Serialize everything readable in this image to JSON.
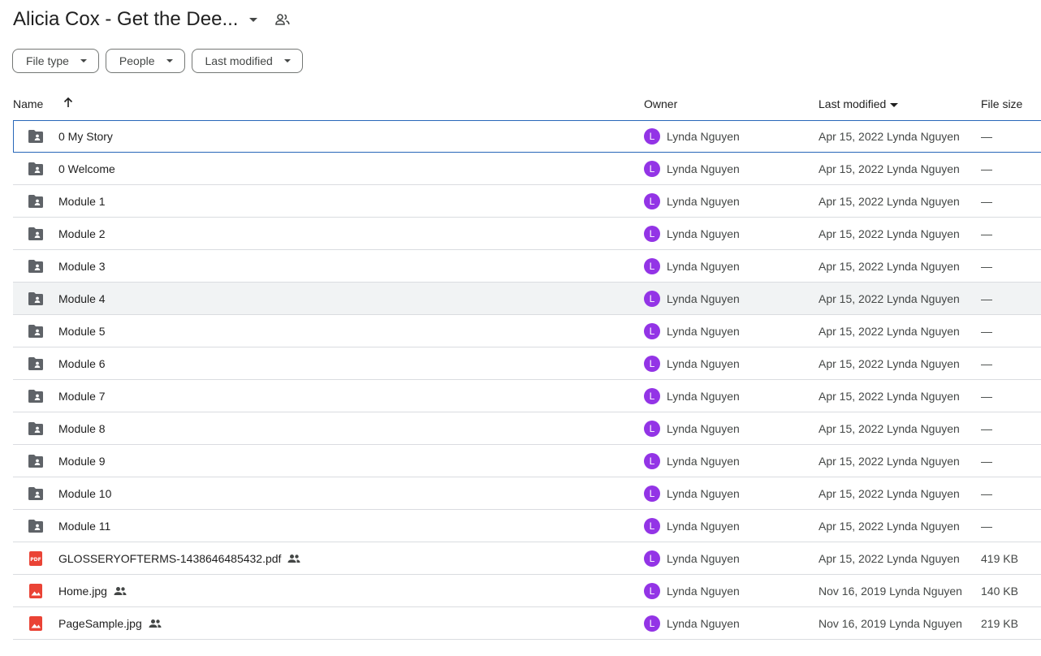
{
  "header": {
    "title": "Alicia Cox - Get the Dee...",
    "icons": [
      "dropdown-caret-icon",
      "shared-people-icon"
    ]
  },
  "filters": [
    {
      "label": "File type"
    },
    {
      "label": "People"
    },
    {
      "label": "Last modified"
    }
  ],
  "columns": {
    "name": "Name",
    "owner": "Owner",
    "last_modified": "Last modified",
    "file_size": "File size"
  },
  "colors": {
    "avatar": "#9334e6",
    "pdf": "#ea4335",
    "image": "#ea4335",
    "folder": "#5f6368",
    "selection_border": "#2867b9",
    "hover_bg": "#f1f3f4"
  },
  "rows": [
    {
      "name": "0 My Story",
      "kind": "folder",
      "shared": false,
      "avatar": "L",
      "owner": "Lynda Nguyen",
      "modified": "Apr 15, 2022 Lynda Nguyen",
      "size": "—"
    },
    {
      "name": "0 Welcome",
      "kind": "folder",
      "shared": false,
      "avatar": "L",
      "owner": "Lynda Nguyen",
      "modified": "Apr 15, 2022 Lynda Nguyen",
      "size": "—"
    },
    {
      "name": "Module 1",
      "kind": "folder",
      "shared": false,
      "avatar": "L",
      "owner": "Lynda Nguyen",
      "modified": "Apr 15, 2022 Lynda Nguyen",
      "size": "—"
    },
    {
      "name": "Module 2",
      "kind": "folder",
      "shared": false,
      "avatar": "L",
      "owner": "Lynda Nguyen",
      "modified": "Apr 15, 2022 Lynda Nguyen",
      "size": "—"
    },
    {
      "name": "Module 3",
      "kind": "folder",
      "shared": false,
      "avatar": "L",
      "owner": "Lynda Nguyen",
      "modified": "Apr 15, 2022 Lynda Nguyen",
      "size": "—"
    },
    {
      "name": "Module 4",
      "kind": "folder",
      "shared": false,
      "avatar": "L",
      "owner": "Lynda Nguyen",
      "modified": "Apr 15, 2022 Lynda Nguyen",
      "size": "—"
    },
    {
      "name": "Module 5",
      "kind": "folder",
      "shared": false,
      "avatar": "L",
      "owner": "Lynda Nguyen",
      "modified": "Apr 15, 2022 Lynda Nguyen",
      "size": "—"
    },
    {
      "name": "Module 6",
      "kind": "folder",
      "shared": false,
      "avatar": "L",
      "owner": "Lynda Nguyen",
      "modified": "Apr 15, 2022 Lynda Nguyen",
      "size": "—"
    },
    {
      "name": "Module 7",
      "kind": "folder",
      "shared": false,
      "avatar": "L",
      "owner": "Lynda Nguyen",
      "modified": "Apr 15, 2022 Lynda Nguyen",
      "size": "—"
    },
    {
      "name": "Module 8",
      "kind": "folder",
      "shared": false,
      "avatar": "L",
      "owner": "Lynda Nguyen",
      "modified": "Apr 15, 2022 Lynda Nguyen",
      "size": "—"
    },
    {
      "name": "Module 9",
      "kind": "folder",
      "shared": false,
      "avatar": "L",
      "owner": "Lynda Nguyen",
      "modified": "Apr 15, 2022 Lynda Nguyen",
      "size": "—"
    },
    {
      "name": "Module 10",
      "kind": "folder",
      "shared": false,
      "avatar": "L",
      "owner": "Lynda Nguyen",
      "modified": "Apr 15, 2022 Lynda Nguyen",
      "size": "—"
    },
    {
      "name": "Module 11",
      "kind": "folder",
      "shared": false,
      "avatar": "L",
      "owner": "Lynda Nguyen",
      "modified": "Apr 15, 2022 Lynda Nguyen",
      "size": "—"
    },
    {
      "name": "GLOSSERYOFTERMS-1438646485432.pdf",
      "kind": "pdf",
      "shared": true,
      "avatar": "L",
      "owner": "Lynda Nguyen",
      "modified": "Apr 15, 2022 Lynda Nguyen",
      "size": "419 KB"
    },
    {
      "name": "Home.jpg",
      "kind": "image",
      "shared": true,
      "avatar": "L",
      "owner": "Lynda Nguyen",
      "modified": "Nov 16, 2019 Lynda Nguyen",
      "size": "140 KB"
    },
    {
      "name": "PageSample.jpg",
      "kind": "image",
      "shared": true,
      "avatar": "L",
      "owner": "Lynda Nguyen",
      "modified": "Nov 16, 2019 Lynda Nguyen",
      "size": "219 KB"
    }
  ]
}
